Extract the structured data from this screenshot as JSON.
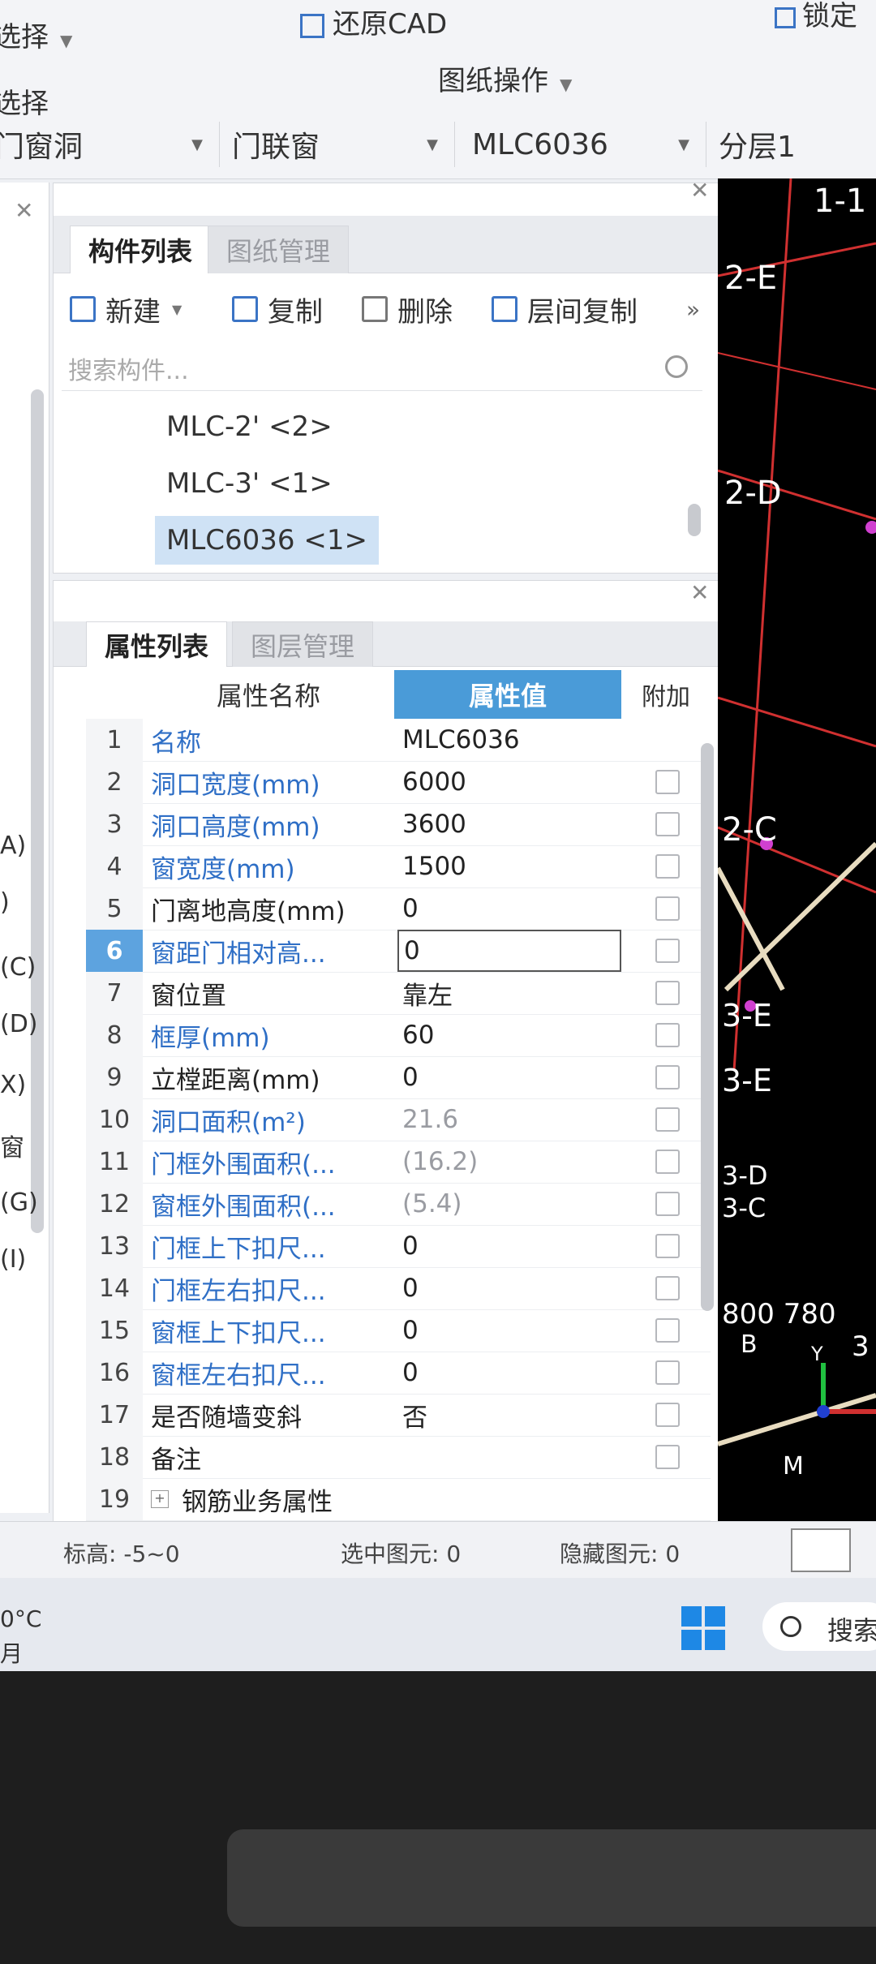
{
  "ribbon": {
    "select_label": "选择",
    "select_label2": "选择",
    "restore_cad": "还原CAD",
    "lock_label": "锁定",
    "drawing_ops": "图纸操作"
  },
  "filters": {
    "category": "门窗洞",
    "type": "门联窗",
    "component": "MLC6036",
    "layer": "分层1"
  },
  "left_strip": {
    "items": [
      "A)",
      ")",
      "(C)",
      "(D)",
      "X)",
      "窗",
      "(G)",
      "(I)"
    ]
  },
  "component_panel": {
    "tabs": [
      "构件列表",
      "图纸管理"
    ],
    "toolbar": {
      "new": "新建",
      "copy": "复制",
      "delete": "删除",
      "floor_copy": "层间复制",
      "more": "»"
    },
    "search_placeholder": "搜索构件...",
    "items": [
      "MLC-2' <2>",
      "MLC-3' <1>",
      "MLC6036   <1>"
    ],
    "selected_index": 2
  },
  "property_panel": {
    "tabs": [
      "属性列表",
      "图层管理"
    ],
    "headers": [
      "属性名称",
      "属性值",
      "附加"
    ],
    "rows": [
      {
        "n": "1",
        "name": "名称",
        "value": "MLC6036"
      },
      {
        "n": "2",
        "name": "洞口宽度(mm)",
        "value": "6000"
      },
      {
        "n": "3",
        "name": "洞口高度(mm)",
        "value": "3600"
      },
      {
        "n": "4",
        "name": "窗宽度(mm)",
        "value": "1500"
      },
      {
        "n": "5",
        "name": "门离地高度(mm)",
        "value": "0"
      },
      {
        "n": "6",
        "name": "窗距门相对高...",
        "value": "0"
      },
      {
        "n": "7",
        "name": "窗位置",
        "value": "靠左"
      },
      {
        "n": "8",
        "name": "框厚(mm)",
        "value": "60"
      },
      {
        "n": "9",
        "name": "立樘距离(mm)",
        "value": "0"
      },
      {
        "n": "10",
        "name": "洞口面积(m²)",
        "value": "21.6"
      },
      {
        "n": "11",
        "name": "门框外围面积(...",
        "value": "(16.2)"
      },
      {
        "n": "12",
        "name": "窗框外围面积(...",
        "value": "(5.4)"
      },
      {
        "n": "13",
        "name": "门框上下扣尺...",
        "value": "0"
      },
      {
        "n": "14",
        "name": "门框左右扣尺...",
        "value": "0"
      },
      {
        "n": "15",
        "name": "窗框上下扣尺...",
        "value": "0"
      },
      {
        "n": "16",
        "name": "窗框左右扣尺...",
        "value": "0"
      },
      {
        "n": "17",
        "name": "是否随墙变斜",
        "value": "否"
      },
      {
        "n": "18",
        "name": "备注",
        "value": ""
      },
      {
        "n": "19",
        "name": "钢筋业务属性",
        "value": ""
      }
    ]
  },
  "statusbar": {
    "elevation": "标高:  -5~0",
    "selected": "选中图元:  0",
    "hidden": "隐藏图元:  0"
  },
  "taskbar": {
    "weather": "0°C",
    "weather2": "月",
    "search": "搜索"
  },
  "cad": {
    "labels": [
      "1-1",
      "2-E",
      "2-D",
      "2-C",
      "3-E",
      "3-E",
      "3-D",
      "3-C",
      "800 780",
      "3",
      "B",
      "Y",
      "M"
    ]
  }
}
